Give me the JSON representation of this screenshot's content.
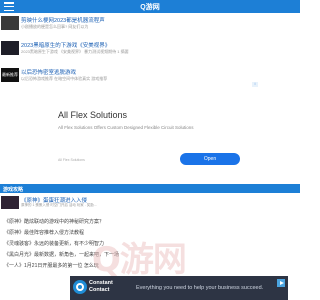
{
  "header": {
    "title": "Q游网",
    "menu_icon": "hamburger-menu-icon"
  },
  "news": [
    {
      "thumb_text": "",
      "headline": "剪映什么梗网2023都是机器流程声",
      "excerpt": "小剧播放的梗是怎么回事? 网友们以为"
    },
    {
      "thumb_text": "",
      "headline": "2023黑暗原生的下游戏《安美视界》",
      "excerpt": "2023黑暗原生下游戏 《安美视界》 暴力测试视频期待 1 摘要"
    },
    {
      "thumb_text": "最新推荐",
      "headline": "以后恐怖密室逃脱游戏",
      "excerpt": "以后恐怖游戏推荐 在暗空间中体验真实 游戏推荐"
    }
  ],
  "ad": {
    "badge": "i",
    "title": "All Flex Solutions",
    "text": "All Flex Solutions Offers Custom Designed Flexible Circuit Solutions",
    "footer": "All Flex Solutions",
    "button": "Open"
  },
  "section": {
    "label": "游戏攻略"
  },
  "feature": {
    "headline": "《原神》蛋蛋狂潮进入入侵",
    "excerpt": "原神的 1 蛋蛋入侵 时空门开启 活动 玩家 . 奖励..."
  },
  "links": [
    {
      "prefix": "《原神》",
      "text": "酷炫联动的游戏中的神秘研究方案？"
    },
    {
      "prefix": "《原神》",
      "text": "最佳阵容推荐入侵方法教程"
    },
    {
      "prefix": "《灵魂骇客》",
      "text": "永远的装备更新，有不少明智力"
    },
    {
      "prefix": "《黑白月光》",
      "text": "最新数据，新角色，一起来吧，下一场"
    },
    {
      "prefix": "《一人》",
      "text": "1月21日开服最多的第一位 怎么玩"
    }
  ],
  "watermark": "Q游网",
  "banner": {
    "brand_line1": "Constant",
    "brand_line2": "Contact",
    "tagline": "Everything you need to help your business succeed.",
    "play_icon": "ad-choices-play-icon"
  },
  "colors": {
    "header_blue": "#1d7fd6",
    "link_blue": "#1a5fb4",
    "button_blue": "#1a73e8",
    "banner_dark": "#2d3444"
  }
}
